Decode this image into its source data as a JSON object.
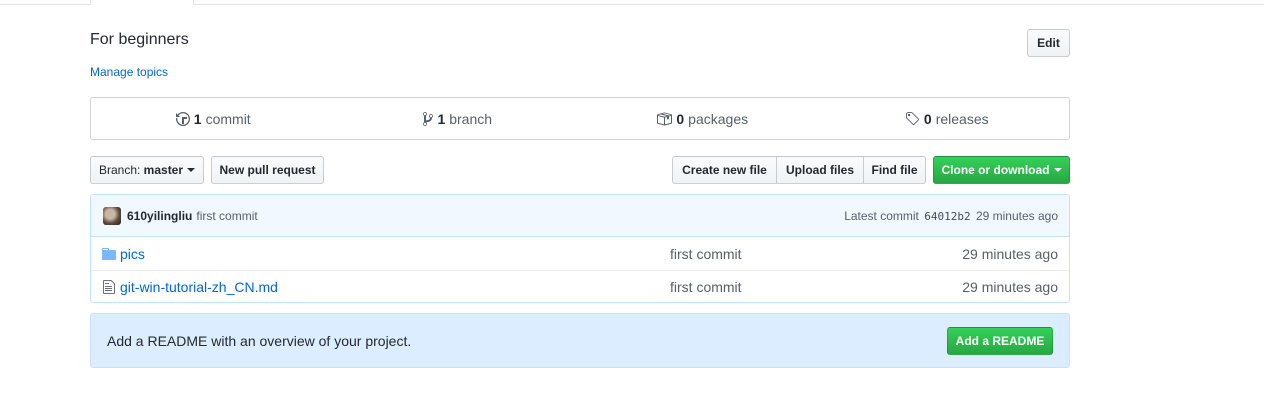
{
  "repo": {
    "description": "For beginners",
    "manage_topics": "Manage topics",
    "edit_label": "Edit"
  },
  "summary": [
    {
      "icon": "commit-history-icon",
      "count": "1",
      "label": "commit"
    },
    {
      "icon": "git-branch-icon",
      "count": "1",
      "label": "branch"
    },
    {
      "icon": "package-icon",
      "count": "0",
      "label": "packages"
    },
    {
      "icon": "tag-icon",
      "count": "0",
      "label": "releases"
    }
  ],
  "toolbar": {
    "branch_prefix": "Branch:",
    "branch_name": "master",
    "new_pr": "New pull request",
    "create_file": "Create new file",
    "upload_files": "Upload files",
    "find_file": "Find file",
    "clone": "Clone or download"
  },
  "latest_commit": {
    "author": "610yilingliu",
    "message": "first commit",
    "prefix": "Latest commit",
    "sha": "64012b2",
    "age": "29 minutes ago"
  },
  "files": [
    {
      "type": "folder",
      "icon": "folder-icon",
      "name": "pics",
      "message": "first commit",
      "age": "29 minutes ago"
    },
    {
      "type": "file",
      "icon": "file-icon",
      "name": "git-win-tutorial-zh_CN.md",
      "message": "first commit",
      "age": "29 minutes ago"
    }
  ],
  "readme": {
    "text": "Add a README with an overview of your project.",
    "button": "Add a README"
  },
  "colors": {
    "link": "#0366d6",
    "primary_green": "#28a745",
    "readme_bg": "#dbedff",
    "commit_bar_bg": "#f1f8ff"
  }
}
